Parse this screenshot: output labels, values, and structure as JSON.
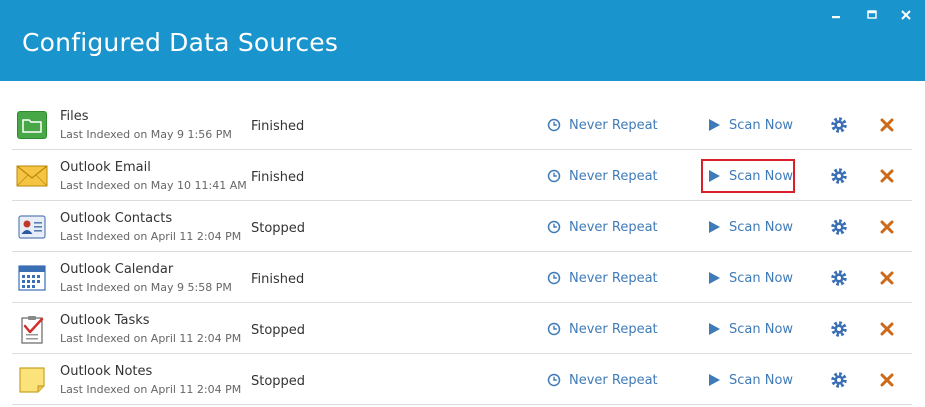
{
  "window": {
    "title": "Configured Data Sources",
    "accent_color": "#1a94cc",
    "controls": [
      "minimize-icon",
      "maximize-icon",
      "close-icon"
    ]
  },
  "sources": [
    {
      "name": "Files",
      "indexed": "Last Indexed on May 9 1:56 PM",
      "status": "Finished",
      "repeat": "Never Repeat",
      "scan": "Scan Now",
      "icon": "folder-icon"
    },
    {
      "name": "Outlook Email",
      "indexed": "Last Indexed on May 10 11:41 AM",
      "status": "Finished",
      "repeat": "Never Repeat",
      "scan": "Scan Now",
      "icon": "envelope-icon"
    },
    {
      "name": "Outlook Contacts",
      "indexed": "Last Indexed on April 11 2:04 PM",
      "status": "Stopped",
      "repeat": "Never Repeat",
      "scan": "Scan Now",
      "icon": "contact-card-icon"
    },
    {
      "name": "Outlook Calendar",
      "indexed": "Last Indexed on May 9 5:58 PM",
      "status": "Finished",
      "repeat": "Never Repeat",
      "scan": "Scan Now",
      "icon": "calendar-icon"
    },
    {
      "name": "Outlook Tasks",
      "indexed": "Last Indexed on April 11 2:04 PM",
      "status": "Stopped",
      "repeat": "Never Repeat",
      "scan": "Scan Now",
      "icon": "task-checklist-icon"
    },
    {
      "name": "Outlook Notes",
      "indexed": "Last Indexed on April 11 2:04 PM",
      "status": "Stopped",
      "repeat": "Never Repeat",
      "scan": "Scan Now",
      "icon": "sticky-note-icon"
    }
  ],
  "colors": {
    "link": "#3f7bb8",
    "gear": "#3a6fb5",
    "delete": "#cc6a1a",
    "highlight": "#d9202a"
  }
}
